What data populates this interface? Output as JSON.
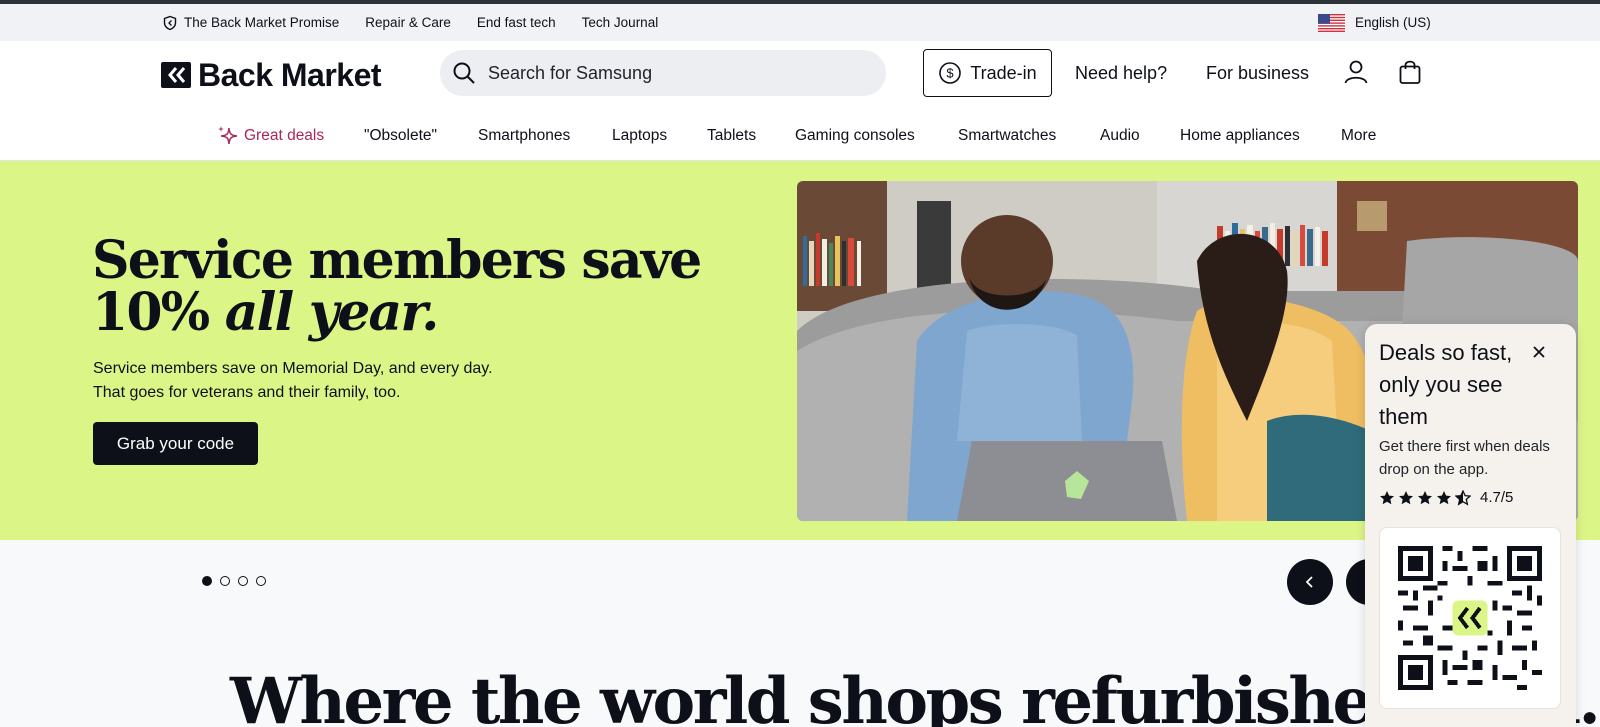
{
  "topbar": {
    "links": [
      {
        "label": "The Back Market Promise",
        "icon": "shield-icon"
      },
      {
        "label": "Repair & Care"
      },
      {
        "label": "End fast tech"
      },
      {
        "label": "Tech Journal"
      }
    ],
    "language": {
      "label": "English (US)",
      "icon": "us-flag-icon"
    }
  },
  "header": {
    "logo_text": "Back Market",
    "search_placeholder": "Search for Samsung",
    "trade_in_label": "Trade-in",
    "need_help_label": "Need help?",
    "for_business_label": "For business",
    "icons": [
      "user-icon",
      "shopping-bag-icon"
    ]
  },
  "nav": {
    "items": [
      "Great deals",
      "\"Obsolete\"",
      "Smartphones",
      "Laptops",
      "Tablets",
      "Gaming consoles",
      "Smartwatches",
      "Audio",
      "Home appliances",
      "More"
    ]
  },
  "hero": {
    "title_line1": "Service members save",
    "title_line2_prefix": "10%",
    "title_line2_em": "all year.",
    "subtitle_line1": "Service members save on Memorial Day, and every day.",
    "subtitle_line2": "That goes for veterans and their family, too.",
    "button_label": "Grab your code",
    "background_color": "#dcf587"
  },
  "carousel": {
    "slide_count": 4,
    "active_index": 0
  },
  "tagline": "Where the world shops refurbished tech.",
  "promo": {
    "title": "Deals so fast, only you see them",
    "text": "Get there first when deals drop on the app.",
    "rating": "4.7/5",
    "stars": 4.5
  },
  "colors": {
    "brand_dark": "#0e1019",
    "deals_accent": "#a8285a",
    "hero_green": "#dcf587"
  }
}
